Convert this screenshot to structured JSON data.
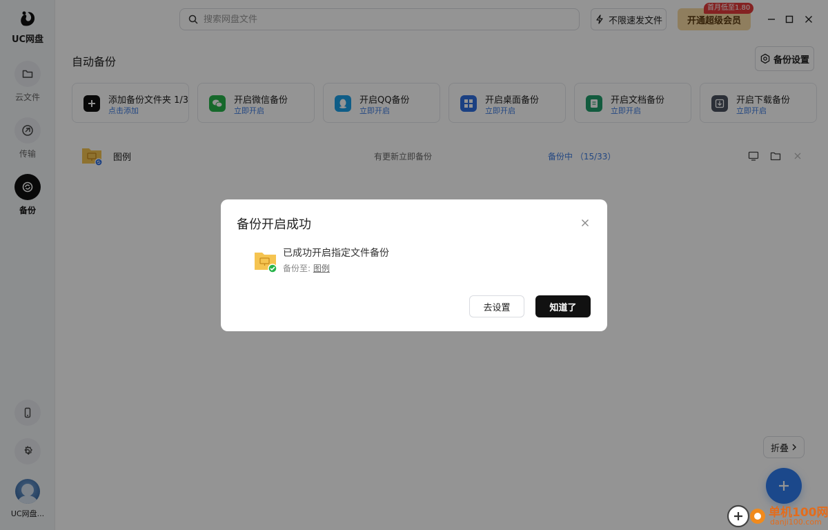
{
  "app": {
    "logo_text": "UC网盘"
  },
  "sidebar": {
    "items": [
      {
        "label": "云文件",
        "icon": "folder-icon"
      },
      {
        "label": "传输",
        "icon": "transfer-icon"
      },
      {
        "label": "备份",
        "icon": "backup-icon",
        "active": true
      }
    ],
    "bottom_buttons": [
      {
        "icon": "phone-icon"
      },
      {
        "icon": "gear-icon"
      }
    ],
    "user_name": "UC网盘..."
  },
  "topbar": {
    "search_placeholder": "搜索网盘文件",
    "speed_label": "不限速发文件",
    "vip_label": "开通超级会员",
    "vip_badge": "首月低至1.80"
  },
  "main": {
    "title": "自动备份",
    "settings_label": "备份设置",
    "cards": [
      {
        "title": "添加备份文件夹 1/3",
        "sub": "点击添加",
        "icon": "plus-icon",
        "color": "#111111"
      },
      {
        "title": "开启微信备份",
        "sub": "立即开启",
        "icon": "wechat-icon",
        "color": "#27b34a"
      },
      {
        "title": "开启QQ备份",
        "sub": "立即开启",
        "icon": "qq-icon",
        "color": "#1aa0e8"
      },
      {
        "title": "开启桌面备份",
        "sub": "立即开启",
        "icon": "desktop-grid-icon",
        "color": "#2f6fe0"
      },
      {
        "title": "开启文档备份",
        "sub": "立即开启",
        "icon": "document-icon",
        "color": "#1f9d6b"
      },
      {
        "title": "开启下载备份",
        "sub": "立即开启",
        "icon": "download-icon",
        "color": "#4a5160"
      }
    ],
    "backup_row": {
      "name": "图例",
      "policy": "有更新立即备份",
      "status": "备份中 （15/33）"
    },
    "fold_label": "折叠"
  },
  "dialog": {
    "title": "备份开启成功",
    "message": "已成功开启指定文件备份",
    "dest_prefix": "备份至: ",
    "dest_link": "图例",
    "goto_settings": "去设置",
    "ok": "知道了"
  },
  "watermark": {
    "text": "单机100网",
    "url": "danji100.com"
  },
  "colors": {
    "accent": "#2f7df0",
    "link": "#3d7be0",
    "dark_button": "#111111",
    "vip": "#f6d9a3",
    "badge": "#e33c3c"
  }
}
